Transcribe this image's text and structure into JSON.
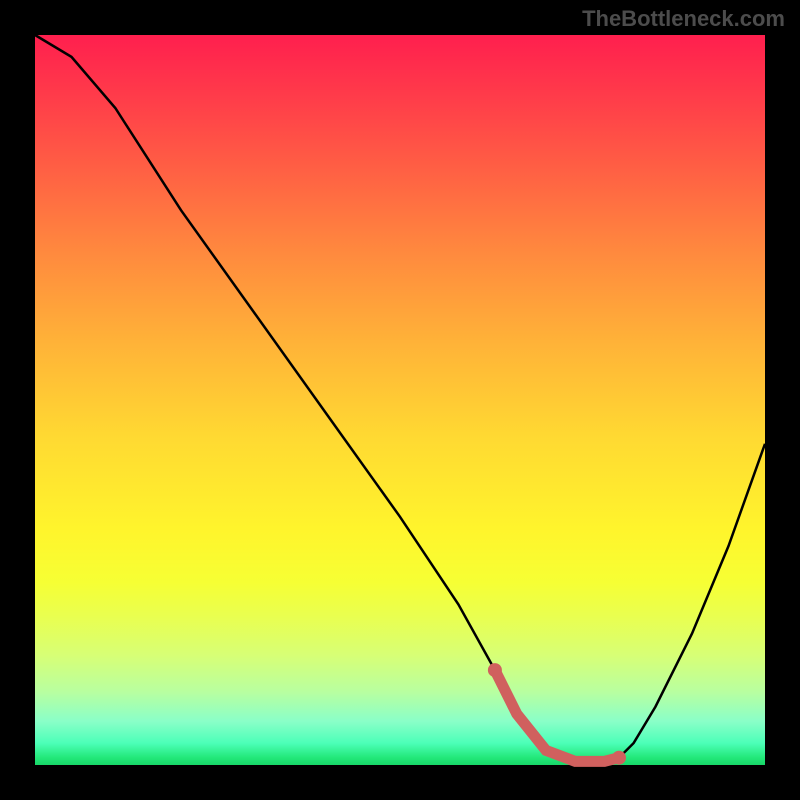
{
  "watermark": "TheBottleneck.com",
  "chart_data": {
    "type": "line",
    "title": "",
    "xlabel": "",
    "ylabel": "",
    "xlim": [
      0,
      100
    ],
    "ylim": [
      0,
      100
    ],
    "series": [
      {
        "name": "curve",
        "x": [
          0,
          5,
          11,
          20,
          30,
          40,
          50,
          58,
          63,
          66,
          70,
          74,
          78,
          80,
          82,
          85,
          90,
          95,
          100
        ],
        "values": [
          100,
          97,
          90,
          76,
          62,
          48,
          34,
          22,
          13,
          7,
          2,
          0.5,
          0.5,
          1,
          3,
          8,
          18,
          30,
          44
        ]
      },
      {
        "name": "highlight",
        "x": [
          63,
          66,
          70,
          74,
          78,
          80
        ],
        "values": [
          13,
          7,
          2,
          0.5,
          0.5,
          1
        ]
      }
    ],
    "colors": {
      "curve": "#000000",
      "highlight": "#d0605e"
    }
  }
}
